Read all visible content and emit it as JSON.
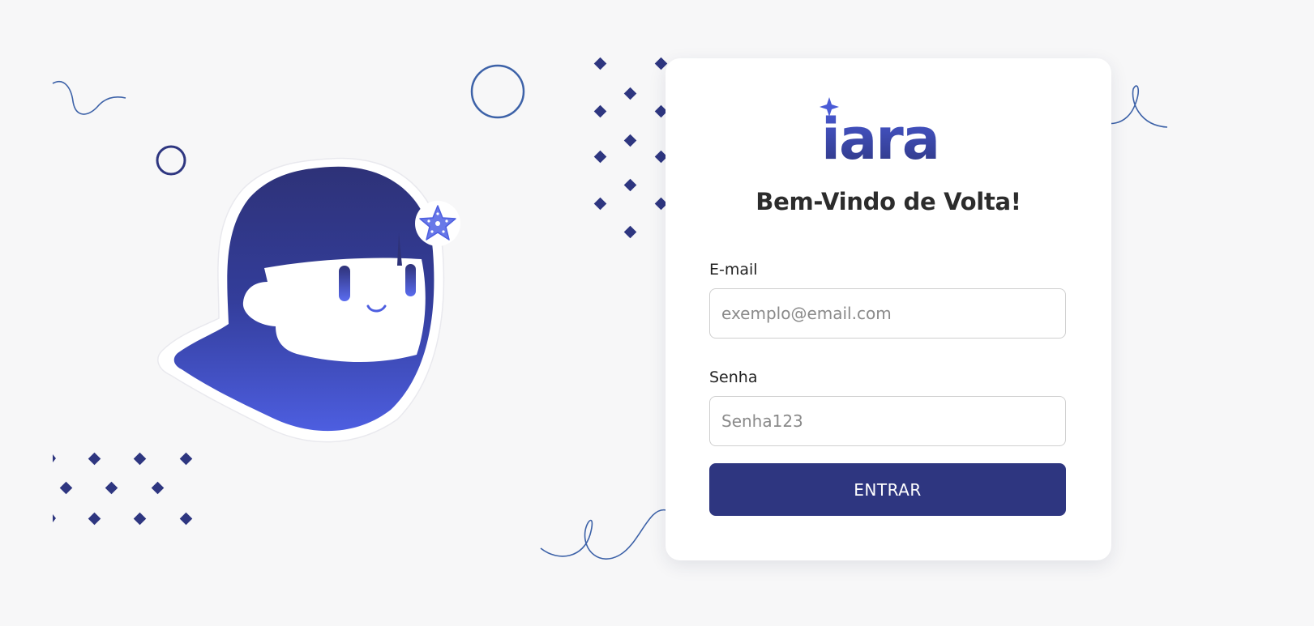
{
  "brand": {
    "logo_text": "iara",
    "color_primary": "#2e3680",
    "color_accent": "#4a5bd6",
    "color_deco_line": "#3d62a8"
  },
  "login": {
    "title": "Bem-Vindo de Volta!",
    "email_label": "E-mail",
    "email_placeholder": "exemplo@email.com",
    "password_label": "Senha",
    "password_placeholder": "Senha123",
    "submit_label": "ENTRAR"
  },
  "icons": {
    "mascot": "mascot-illustration",
    "starfish": "starfish-icon",
    "sparkle": "sparkle-icon"
  }
}
